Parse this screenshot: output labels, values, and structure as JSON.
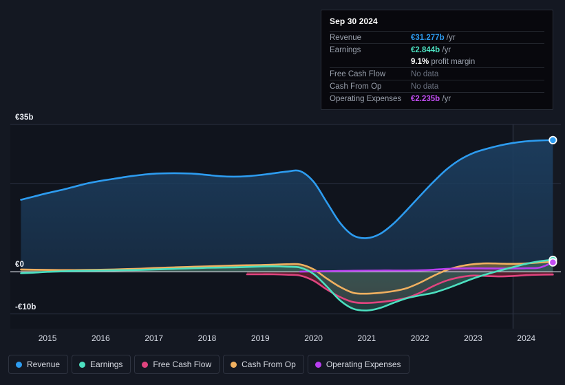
{
  "theme": {
    "background": "#141822",
    "plot_background": "#10141d",
    "gridline": "#2a3040",
    "zero_line": "#c9ccd4",
    "text": "#d6dae4"
  },
  "axes": {
    "y_ticks": [
      {
        "label": "€35b",
        "value": 35
      },
      {
        "label": "€0",
        "value": 0
      },
      {
        "label": "-€10b",
        "value": -10
      }
    ],
    "x_ticks": [
      "2015",
      "2016",
      "2017",
      "2018",
      "2019",
      "2020",
      "2021",
      "2022",
      "2023",
      "2024"
    ]
  },
  "tooltip": {
    "date": "Sep 30 2024",
    "rows": [
      {
        "key": "Revenue",
        "amount": "€31.277b",
        "unit": "/yr",
        "color": "#2d9cf0",
        "no_data": false
      },
      {
        "key": "Earnings",
        "amount": "€2.844b",
        "unit": "/yr",
        "color": "#4ce0c0",
        "no_data": false
      },
      {
        "key": "",
        "amount": "9.1%",
        "unit": "profit margin",
        "color": "#ffffff",
        "no_data": false,
        "sub": true
      },
      {
        "key": "Free Cash Flow",
        "amount": "No data",
        "unit": "",
        "color": "#6b7280",
        "no_data": true
      },
      {
        "key": "Cash From Op",
        "amount": "No data",
        "unit": "",
        "color": "#6b7280",
        "no_data": true
      },
      {
        "key": "Operating Expenses",
        "amount": "€2.235b",
        "unit": "/yr",
        "color": "#c44ef5",
        "no_data": false
      }
    ]
  },
  "legend": {
    "items": [
      {
        "label": "Revenue",
        "color": "#2d9cf0"
      },
      {
        "label": "Earnings",
        "color": "#4ce0c0"
      },
      {
        "label": "Free Cash Flow",
        "color": "#e0447f"
      },
      {
        "label": "Cash From Op",
        "color": "#f0b060"
      },
      {
        "label": "Operating Expenses",
        "color": "#b83ef0"
      }
    ]
  },
  "chart_data": {
    "type": "area",
    "title": "",
    "xlabel": "",
    "ylabel": "",
    "currency": "EUR",
    "unit": "billions",
    "ylim": [
      -13.5,
      35
    ],
    "xlim": [
      2014.55,
      2024.9
    ],
    "grid": true,
    "legend_position": "bottom",
    "y_gridlines": [
      35,
      21,
      0,
      -10
    ],
    "highlight_band": {
      "from": 2024.0,
      "to": 2024.9
    },
    "x": [
      2014.75,
      2015.0,
      2015.25,
      2015.5,
      2015.75,
      2016.0,
      2016.25,
      2016.5,
      2016.75,
      2017.0,
      2017.25,
      2017.5,
      2017.75,
      2018.0,
      2018.25,
      2018.5,
      2018.75,
      2019.0,
      2019.25,
      2019.5,
      2019.75,
      2020.0,
      2020.25,
      2020.5,
      2020.75,
      2021.0,
      2021.25,
      2021.5,
      2021.75,
      2022.0,
      2022.25,
      2022.5,
      2022.75,
      2023.0,
      2023.25,
      2023.5,
      2023.75,
      2024.0,
      2024.25,
      2024.5,
      2024.75
    ],
    "series": [
      {
        "name": "Revenue",
        "color": "#2d9cf0",
        "fill": "#1c3d5e",
        "values": [
          17.1,
          17.9,
          18.7,
          19.4,
          20.2,
          21.0,
          21.6,
          22.1,
          22.6,
          23.0,
          23.3,
          23.4,
          23.4,
          23.3,
          23.0,
          22.7,
          22.6,
          22.7,
          23.0,
          23.4,
          23.8,
          23.9,
          21.4,
          16.5,
          11.6,
          8.6,
          8.0,
          9.0,
          11.4,
          14.6,
          18.0,
          21.3,
          24.3,
          26.6,
          28.2,
          29.2,
          30.0,
          30.6,
          31.0,
          31.2,
          31.277
        ]
      },
      {
        "name": "Earnings",
        "color": "#4ce0c0",
        "fill": "#2f5a55",
        "values": [
          -0.35,
          -0.2,
          0.0,
          0.1,
          0.2,
          0.25,
          0.3,
          0.35,
          0.4,
          0.45,
          0.55,
          0.65,
          0.75,
          0.85,
          0.95,
          1.0,
          1.05,
          1.15,
          1.25,
          1.3,
          1.2,
          1.0,
          -0.5,
          -3.5,
          -6.8,
          -8.8,
          -9.2,
          -8.6,
          -7.4,
          -6.3,
          -5.6,
          -5.0,
          -4.0,
          -2.8,
          -1.6,
          -0.6,
          0.3,
          1.1,
          1.9,
          2.5,
          2.844
        ]
      },
      {
        "name": "Free Cash Flow",
        "color": "#e0447f",
        "fill": "#5e2030",
        "values": [
          null,
          null,
          null,
          null,
          null,
          null,
          null,
          null,
          null,
          null,
          null,
          null,
          null,
          null,
          null,
          null,
          null,
          -0.6,
          -0.6,
          -0.6,
          -0.7,
          -0.9,
          -2.1,
          -4.2,
          -6.0,
          -7.2,
          -7.4,
          -7.2,
          -6.8,
          -6.2,
          -5.0,
          -3.4,
          -2.1,
          -1.3,
          -0.9,
          -1.0,
          -1.1,
          -1.0,
          -0.8,
          -0.7,
          -0.65
        ]
      },
      {
        "name": "Cash From Op",
        "color": "#f0b060",
        "fill": "#6b6040",
        "values": [
          0.55,
          0.5,
          0.45,
          0.42,
          0.42,
          0.45,
          0.5,
          0.55,
          0.65,
          0.75,
          0.9,
          1.0,
          1.1,
          1.2,
          1.3,
          1.4,
          1.5,
          1.55,
          1.6,
          1.7,
          1.8,
          1.75,
          0.6,
          -1.6,
          -3.6,
          -5.0,
          -5.2,
          -5.0,
          -4.6,
          -3.9,
          -2.6,
          -1.0,
          0.4,
          1.3,
          1.8,
          2.0,
          1.95,
          1.9,
          2.0,
          2.2,
          2.35
        ]
      },
      {
        "name": "Operating Expenses",
        "color": "#b83ef0",
        "fill": "#4a2a66",
        "values": [
          null,
          null,
          null,
          null,
          null,
          null,
          null,
          null,
          null,
          null,
          null,
          null,
          null,
          null,
          null,
          null,
          null,
          null,
          null,
          null,
          null,
          0.05,
          0.1,
          0.15,
          0.2,
          0.25,
          0.28,
          0.3,
          0.3,
          0.3,
          0.35,
          0.5,
          0.7,
          0.8,
          0.82,
          0.8,
          0.78,
          0.8,
          0.85,
          1.0,
          2.235
        ]
      }
    ],
    "end_markers": [
      {
        "name": "Revenue",
        "value": 31.277,
        "color": "#2d9cf0"
      },
      {
        "name": "Earnings",
        "value": 2.844,
        "color": "#4ce0c0"
      },
      {
        "name": "Operating Expenses",
        "value": 2.235,
        "color": "#c44ef5"
      }
    ]
  }
}
